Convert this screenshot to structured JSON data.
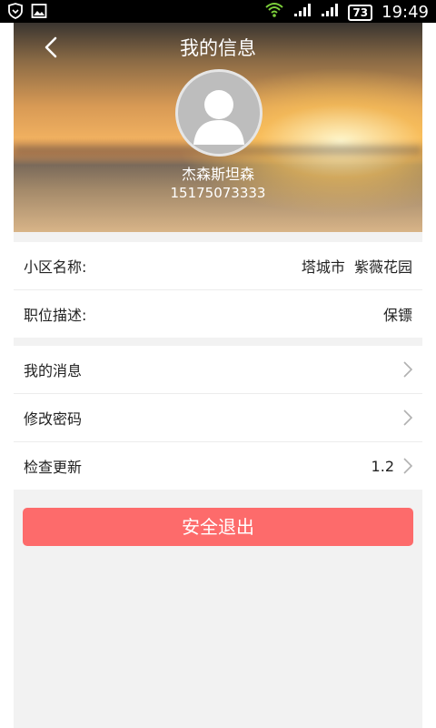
{
  "status_bar": {
    "battery": "73",
    "time": "19:49",
    "icons": [
      "shield-heart-icon",
      "image-icon",
      "wifi-icon",
      "signal-icon",
      "signal-icon",
      "battery-icon"
    ]
  },
  "header": {
    "title": "我的信息",
    "back_icon": "chevron-left-icon"
  },
  "profile": {
    "avatar_icon": "user-avatar-icon",
    "name": "杰森斯坦森",
    "phone": "15175073333"
  },
  "info": {
    "community_label": "小区名称:",
    "community_value": "塔城市  紫薇花园",
    "position_label": "职位描述:",
    "position_value": "保镖"
  },
  "menu": {
    "messages_label": "我的消息",
    "password_label": "修改密码",
    "update_label": "检查更新",
    "update_version": "1.2"
  },
  "logout": {
    "label": "安全退出"
  },
  "colors": {
    "logout_button": "#fd6b6b",
    "page_bg": "#f2f2f2"
  }
}
